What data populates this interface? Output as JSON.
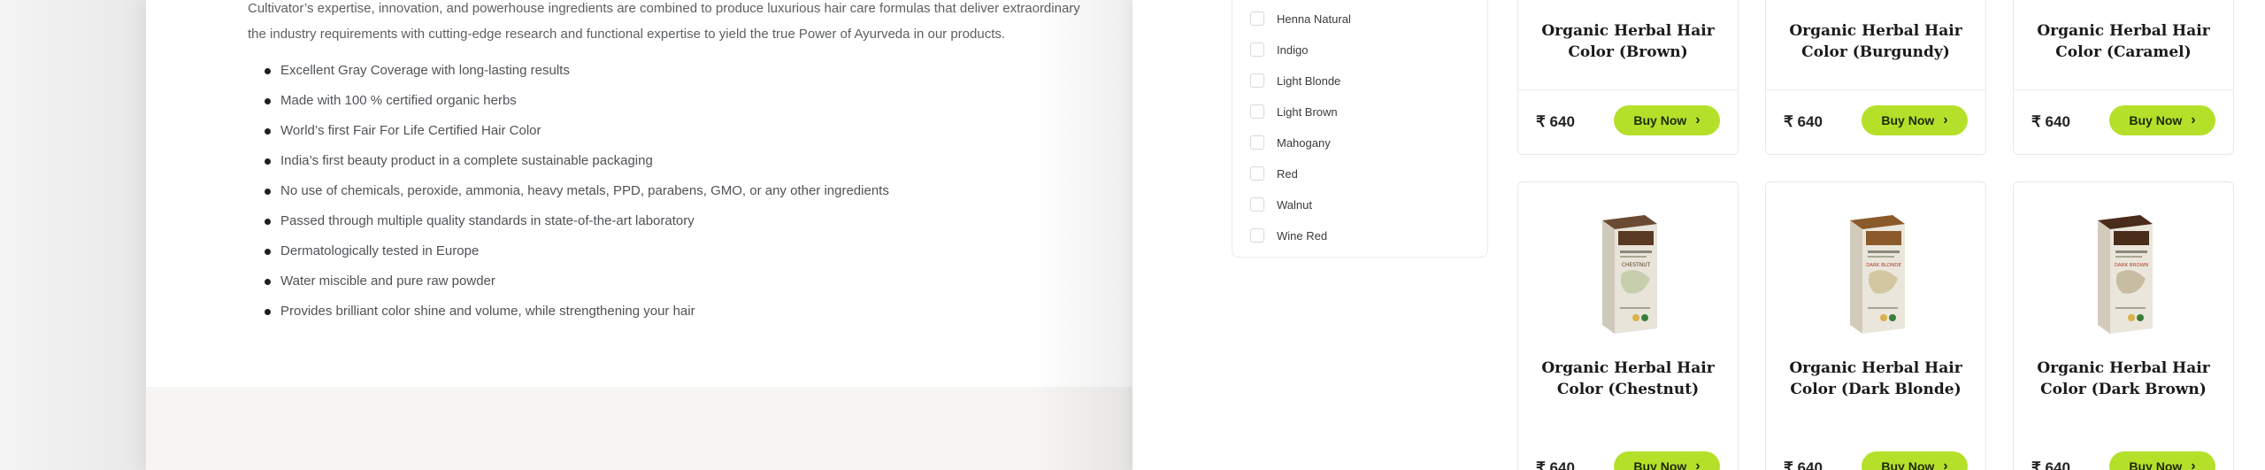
{
  "article": {
    "intro_line1": "Cultivator’s expertise, innovation, and powerhouse ingredients are combined to produce luxurious hair care formulas that deliver extraordinary",
    "intro_line2": "the industry requirements with cutting-edge research and functional expertise to yield the true Power of Ayurveda in our products.",
    "features": [
      "Excellent Gray Coverage with long-lasting results",
      "Made with 100 % certified organic herbs",
      "World’s first Fair For Life Certified Hair Color",
      "India’s first beauty product in a complete sustainable packaging",
      "No use of chemicals, peroxide, ammonia, heavy metals, PPD, parabens, GMO, or any other ingredients",
      "Passed through multiple quality standards in state-of-the-art laboratory",
      "Dermatologically tested in Europe",
      "Water miscible and pure raw powder",
      "Provides brilliant color shine and volume, while strengthening your hair"
    ]
  },
  "filters": {
    "items": [
      "Henna Natural",
      "Indigo",
      "Light Blonde",
      "Light Brown",
      "Mahogany",
      "Red",
      "Walnut",
      "Wine Red"
    ]
  },
  "products": [
    {
      "name_line1": "Organic Herbal Hair",
      "name_line2": "Color (Brown)",
      "price": "₹ 640",
      "button": "Buy Now"
    },
    {
      "name_line1": "Organic Herbal Hair",
      "name_line2": "Color (Burgundy)",
      "price": "₹ 640",
      "button": "Buy Now"
    },
    {
      "name_line1": "Organic Herbal Hair",
      "name_line2": "Color (Caramel)",
      "price": "₹ 640",
      "button": "Buy Now"
    },
    {
      "name_line1": "Organic Herbal Hair",
      "name_line2": "Color (Chestnut)",
      "price": "₹ 640",
      "button": "Buy Now",
      "box_label": "CHESTNUT",
      "box_color": "#5a3a22"
    },
    {
      "name_line1": "Organic Herbal Hair",
      "name_line2": "Color (Dark Blonde)",
      "price": "₹ 640",
      "button": "Buy Now",
      "box_label": "DARK BLONDE",
      "box_color": "#8a5a2b"
    },
    {
      "name_line1": "Organic Herbal Hair",
      "name_line2": "Color (Dark Brown)",
      "price": "₹ 640",
      "button": "Buy Now",
      "box_label": "DARK BROWN",
      "box_color": "#4a2c1a"
    }
  ],
  "colors": {
    "accent_button": "#b5e02a",
    "bullet": "#1f1f1f"
  },
  "icons": {
    "chevron": "chevron-right-icon",
    "checkbox": "checkbox-icon"
  }
}
